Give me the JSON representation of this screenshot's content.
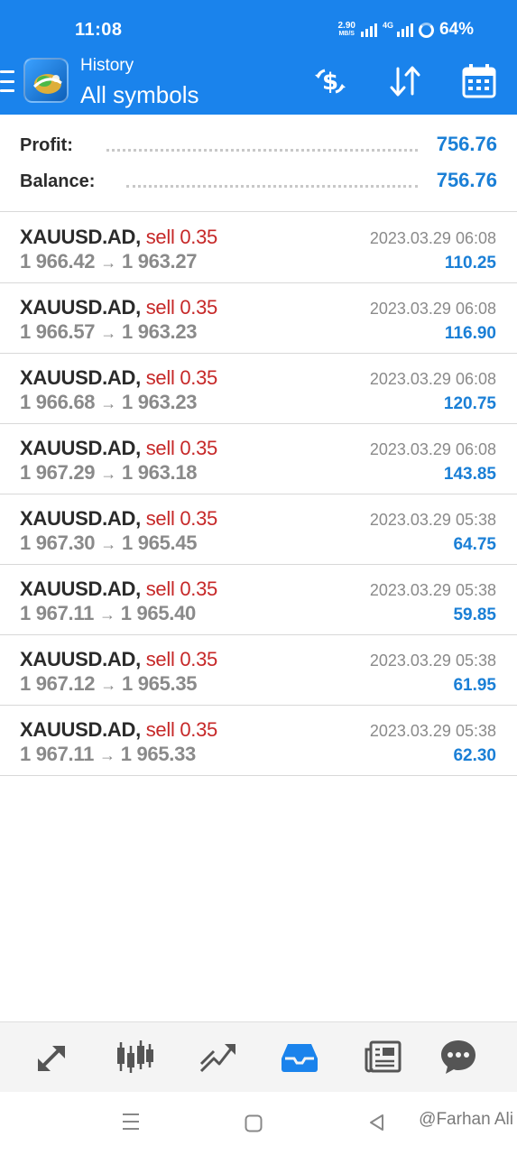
{
  "status_bar": {
    "time": "11:08",
    "net_speed_value": "2.90",
    "net_speed_unit": "MB/S",
    "network": "4G",
    "battery": "64%"
  },
  "app_bar": {
    "subtitle": "History",
    "title": "All symbols",
    "icons": [
      "menu-icon",
      "metatrader-logo",
      "currency-filter-icon",
      "sort-icon",
      "calendar-icon"
    ]
  },
  "summary": {
    "profit_label": "Profit:",
    "profit_value": "756.76",
    "balance_label": "Balance:",
    "balance_value": "756.76"
  },
  "deals": [
    {
      "symbol": "XAUUSD.AD,",
      "side": "sell 0.35",
      "open": "1 966.42",
      "arrow": "→",
      "close": "1 963.27",
      "time": "2023.03.29 06:08",
      "profit": "110.25"
    },
    {
      "symbol": "XAUUSD.AD,",
      "side": "sell 0.35",
      "open": "1 966.57",
      "arrow": "→",
      "close": "1 963.23",
      "time": "2023.03.29 06:08",
      "profit": "116.90"
    },
    {
      "symbol": "XAUUSD.AD,",
      "side": "sell 0.35",
      "open": "1 966.68",
      "arrow": "→",
      "close": "1 963.23",
      "time": "2023.03.29 06:08",
      "profit": "120.75"
    },
    {
      "symbol": "XAUUSD.AD,",
      "side": "sell 0.35",
      "open": "1 967.29",
      "arrow": "→",
      "close": "1 963.18",
      "time": "2023.03.29 06:08",
      "profit": "143.85"
    },
    {
      "symbol": "XAUUSD.AD,",
      "side": "sell 0.35",
      "open": "1 967.30",
      "arrow": "→",
      "close": "1 965.45",
      "time": "2023.03.29 05:38",
      "profit": "64.75"
    },
    {
      "symbol": "XAUUSD.AD,",
      "side": "sell 0.35",
      "open": "1 967.11",
      "arrow": "→",
      "close": "1 965.40",
      "time": "2023.03.29 05:38",
      "profit": "59.85"
    },
    {
      "symbol": "XAUUSD.AD,",
      "side": "sell 0.35",
      "open": "1 967.12",
      "arrow": "→",
      "close": "1 965.35",
      "time": "2023.03.29 05:38",
      "profit": "61.95"
    },
    {
      "symbol": "XAUUSD.AD,",
      "side": "sell 0.35",
      "open": "1 967.11",
      "arrow": "→",
      "close": "1 965.33",
      "time": "2023.03.29 05:38",
      "profit": "62.30"
    }
  ],
  "bottom_nav": {
    "items": [
      "quotes-icon",
      "chart-icon",
      "trade-icon",
      "history-icon",
      "news-icon",
      "chat-icon"
    ],
    "active": "history-icon"
  },
  "system_nav": {
    "watermark": "@Farhan Ali"
  },
  "colors": {
    "accent": "#1a83ec",
    "profit": "#1a7fd6",
    "sell": "#c62828",
    "muted": "#8a8a8a"
  }
}
